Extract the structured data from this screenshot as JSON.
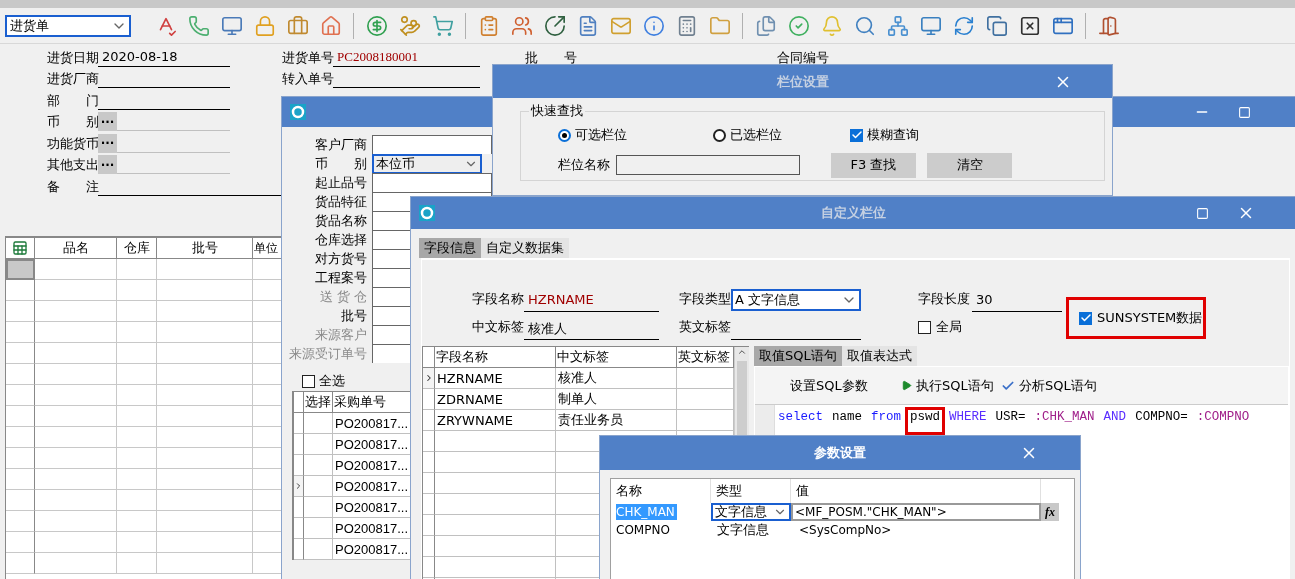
{
  "toolbar": {
    "document_type": "进货单"
  },
  "header_form": {
    "left_fields": [
      {
        "label": "进货日期",
        "kind": "text",
        "value": "2020-08-18"
      },
      {
        "label": "进货厂商",
        "kind": "text"
      },
      {
        "label": "部　　门",
        "kind": "text"
      },
      {
        "label": "币　　别",
        "kind": "lookup",
        "button": "···"
      },
      {
        "label": "功能货币",
        "kind": "lookup",
        "button": "···"
      },
      {
        "label": "其他支出",
        "kind": "lookup",
        "button": "···"
      },
      {
        "label": "备　　注",
        "kind": "wide"
      }
    ],
    "middle_fields": [
      {
        "label": "进货单号",
        "value": "PC2008180001"
      },
      {
        "label": "转入单号"
      }
    ],
    "right_labels": [
      "批　　号",
      "合同编号"
    ]
  },
  "detail_grid": {
    "columns": [
      "品名",
      "仓库",
      "批号",
      "单位"
    ],
    "rows": [
      {
        "selected": true
      },
      {
        "selected": false
      },
      {
        "selected": false
      },
      {
        "selected": false
      },
      {
        "selected": false
      },
      {
        "selected": false
      },
      {
        "selected": false
      },
      {
        "selected": false
      },
      {
        "selected": false
      },
      {
        "selected": false
      },
      {
        "selected": false
      },
      {
        "selected": false
      },
      {
        "selected": false
      },
      {
        "selected": false
      },
      {
        "selected": false
      }
    ]
  },
  "filter_window": {
    "fields": [
      {
        "label": "客户厂商",
        "kind": "input",
        "disabled": false
      },
      {
        "label": "币　　别",
        "kind": "combo",
        "value": "本位币",
        "disabled": false
      },
      {
        "label": "起止品号",
        "kind": "input",
        "disabled": false
      },
      {
        "label": "货品特征",
        "kind": "input",
        "disabled": false
      },
      {
        "label": "货品名称",
        "kind": "input",
        "disabled": false
      },
      {
        "label": "仓库选择",
        "kind": "input",
        "disabled": false
      },
      {
        "label": "对方货号",
        "kind": "input",
        "disabled": false
      },
      {
        "label": "工程案号",
        "kind": "input",
        "disabled": false
      },
      {
        "label": "送 货 仓",
        "kind": "input",
        "disabled": true
      },
      {
        "label": "批号",
        "kind": "input",
        "disabled": false
      },
      {
        "label": "来源客户",
        "kind": "input",
        "disabled": true
      },
      {
        "label": "来源受订单号",
        "kind": "input",
        "disabled": true
      }
    ],
    "select_all": {
      "label": "全选",
      "checked": false
    },
    "columns": [
      "选择",
      "采购单号"
    ],
    "rows": [
      {
        "order_no": "PO200817...",
        "current": false
      },
      {
        "order_no": "PO200817...",
        "current": false
      },
      {
        "order_no": "PO200817...",
        "current": false
      },
      {
        "order_no": "PO200817...",
        "current": true
      },
      {
        "order_no": "PO200817...",
        "current": false
      },
      {
        "order_no": "PO200817...",
        "current": false
      },
      {
        "order_no": "PO200817...",
        "current": false
      }
    ]
  },
  "column_settings": {
    "title": "栏位设置",
    "group": "快速查找",
    "options": [
      {
        "kind": "radio",
        "label": "可选栏位",
        "selected": true
      },
      {
        "kind": "radio",
        "label": "已选栏位",
        "selected": false
      },
      {
        "kind": "checkbox",
        "label": "模糊查询",
        "checked": true
      }
    ],
    "name_label": "栏位名称",
    "buttons": [
      "F3 查找",
      "清空"
    ]
  },
  "custom_column": {
    "title": "自定义栏位",
    "tabs": [
      {
        "label": "字段信息",
        "selected": true
      },
      {
        "label": "自定义数据集",
        "selected": false
      }
    ],
    "field_name": {
      "label": "字段名称",
      "value": "HZRNAME"
    },
    "field_type": {
      "label": "字段类型",
      "value": "A 文字信息"
    },
    "field_length": {
      "label": "字段长度",
      "value": "30"
    },
    "chinese_label": {
      "label": "中文标签",
      "value": "核准人"
    },
    "english_label": {
      "label": "英文标签"
    },
    "global": {
      "label": "全局",
      "checked": false
    },
    "sunsystem": {
      "label": "SUNSYSTEM数据",
      "checked": true,
      "highlighted": true
    },
    "field_grid": {
      "columns": [
        "字段名称",
        "中文标签",
        "英文标签"
      ],
      "rows": [
        {
          "name": "HZRNAME",
          "chinese": "核准人",
          "current": true
        },
        {
          "name": "ZDRNAME",
          "chinese": "制单人",
          "current": false
        },
        {
          "name": "ZRYWNAME",
          "chinese": "责任业务员",
          "current": false
        }
      ]
    },
    "sql_tabs": [
      {
        "label": "取值SQL语句",
        "selected": true
      },
      {
        "label": "取值表达式",
        "selected": false
      }
    ],
    "sql_actions": [
      {
        "kind": "plain",
        "label": "设置SQL参数"
      },
      {
        "kind": "run",
        "label": "执行SQL语句"
      },
      {
        "kind": "check",
        "label": "分析SQL语句"
      }
    ],
    "sql_tokens": [
      {
        "text": "select",
        "kind": "keyword",
        "highlighted": false
      },
      {
        "text": "name",
        "kind": "plain",
        "highlighted": false
      },
      {
        "text": "from",
        "kind": "keyword",
        "highlighted": false
      },
      {
        "text": "pswd",
        "kind": "plain",
        "highlighted": true
      },
      {
        "text": "WHERE",
        "kind": "keyword2",
        "highlighted": false
      },
      {
        "text": "USR=",
        "kind": "plain",
        "highlighted": false
      },
      {
        "text": ":CHK_MAN",
        "kind": "param",
        "highlighted": false
      },
      {
        "text": "AND",
        "kind": "keyword2",
        "highlighted": false
      },
      {
        "text": "COMPNO=",
        "kind": "plain",
        "highlighted": false
      },
      {
        "text": ":COMPNO",
        "kind": "param",
        "highlighted": false
      }
    ]
  },
  "params_window": {
    "title": "参数设置",
    "columns": [
      "名称",
      "类型",
      "值"
    ],
    "formula_button": "fx",
    "rows": [
      {
        "name": "CHK_MAN",
        "type": "文字信息",
        "value": "<MF_POSM.\"CHK_MAN\">",
        "selected": true
      },
      {
        "name": "COMPNO",
        "type": "文字信息",
        "value": "<SysCompNo>",
        "selected": false
      }
    ]
  }
}
